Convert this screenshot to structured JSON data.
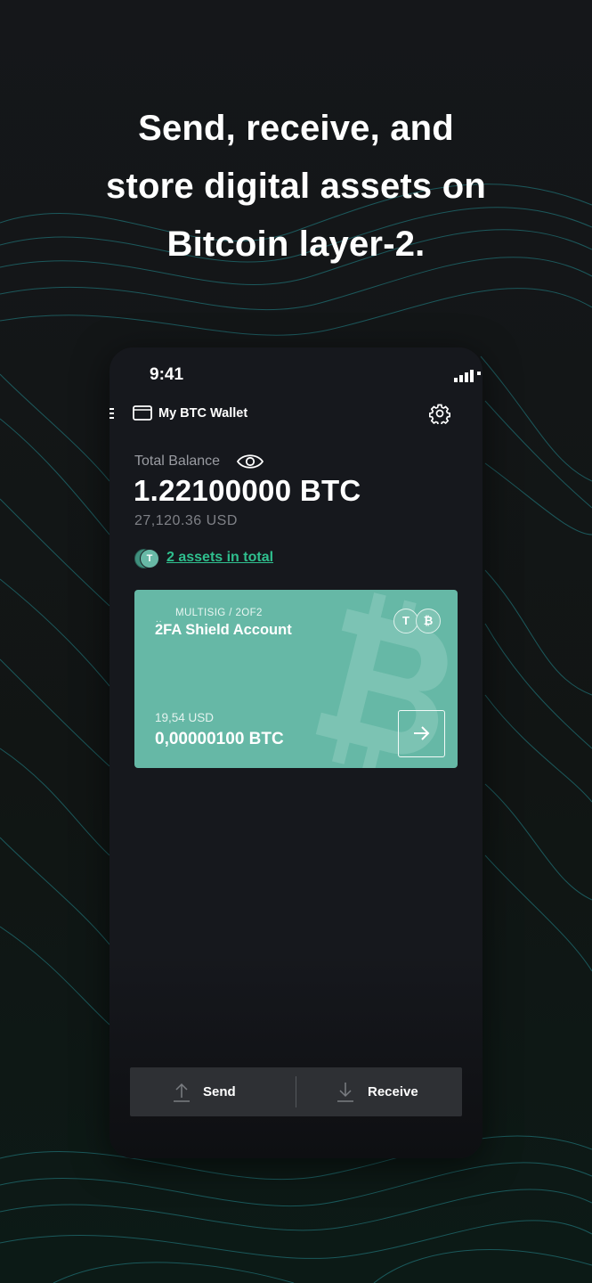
{
  "promo": {
    "headline_lines": [
      "Send, receive, and",
      "store digital assets on",
      "Bitcoin layer-2."
    ]
  },
  "status_bar": {
    "time": "9:41"
  },
  "header": {
    "wallet_name": "My BTC Wallet",
    "icons": [
      "menu-icon",
      "wallet-icon",
      "gear-icon"
    ]
  },
  "balance": {
    "label": "Total Balance",
    "amount": "1.22100000 BTC",
    "fiat": "27,120.36 USD",
    "assets_link": "2 assets in total",
    "coin_symbol": "T"
  },
  "account_card": {
    "type": "MULTISIG / 2OF2",
    "dots": "..",
    "title": "2FA Shield Account",
    "fiat": "19,54 USD",
    "amount": "0,00000100 BTC",
    "coins": [
      "T",
      "₿"
    ],
    "icons": [
      "bitcoin-watermark-icon",
      "arrow-right-icon"
    ]
  },
  "actions": {
    "send_label": "Send",
    "receive_label": "Receive",
    "icons": [
      "send-arrow-up-icon",
      "receive-arrow-down-icon"
    ]
  },
  "colors": {
    "background": "#121417",
    "phone": "#16181d",
    "card": "#66b8a6",
    "link": "#2fbf8e",
    "contour_lines": "#1f6f73",
    "action_bar": "#2e3034"
  }
}
